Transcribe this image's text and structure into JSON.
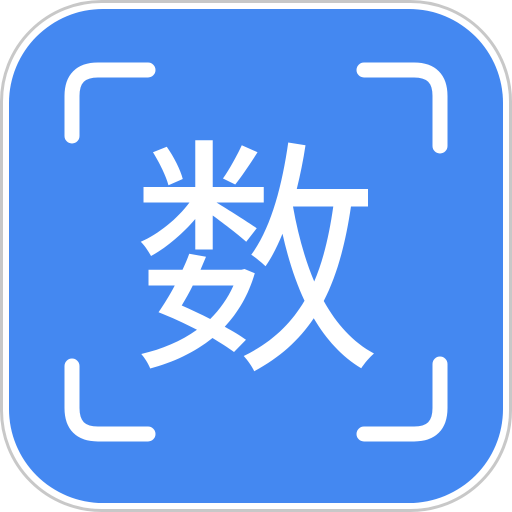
{
  "app_icon": {
    "glyph": "数",
    "background_color": "#4488f1",
    "border_color": "#c8c8c8",
    "foreground_color": "#ffffff"
  }
}
